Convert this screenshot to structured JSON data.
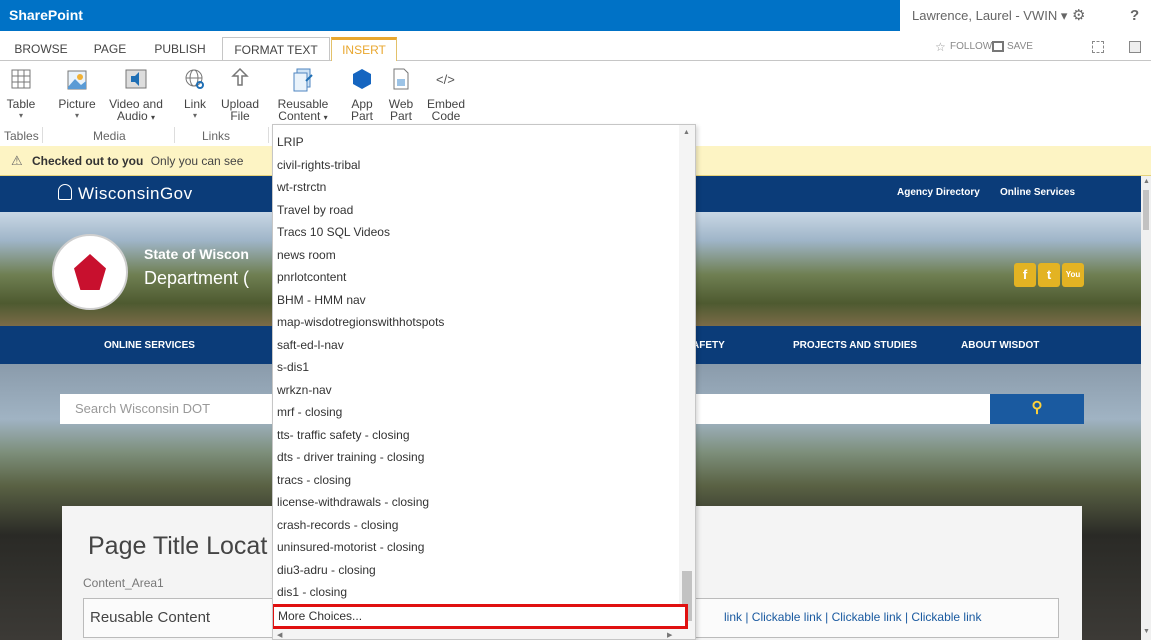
{
  "suite_bar": {
    "brand": "SharePoint",
    "user": "Lawrence, Laurel - VWIN",
    "user_caret": "▾",
    "settings_glyph": "⚙",
    "help_glyph": "?"
  },
  "ribbon_tabs": [
    "BROWSE",
    "PAGE",
    "PUBLISH",
    "FORMAT TEXT",
    "INSERT"
  ],
  "right_actions": {
    "follow": "FOLLOW",
    "save": "SAVE"
  },
  "ribbon": {
    "buttons": [
      {
        "line1": "Table",
        "line2": "",
        "dropdown": "▾"
      },
      {
        "line1": "Picture",
        "line2": "",
        "dropdown": "▾"
      },
      {
        "line1": "Video and",
        "line2": "Audio",
        "dropdown": "▾"
      },
      {
        "line1": "Link",
        "line2": "",
        "dropdown": "▾"
      },
      {
        "line1": "Upload",
        "line2": "File",
        "dropdown": ""
      },
      {
        "line1": "Reusable",
        "line2": "Content",
        "dropdown": "▾"
      },
      {
        "line1": "App",
        "line2": "Part",
        "dropdown": ""
      },
      {
        "line1": "Web",
        "line2": "Part",
        "dropdown": ""
      },
      {
        "line1": "Embed",
        "line2": "Code",
        "dropdown": ""
      }
    ],
    "groups": [
      "Tables",
      "Media",
      "Links"
    ]
  },
  "notice": {
    "icon": "⚠",
    "bold": "Checked out to you",
    "text": "Only you can see"
  },
  "site": {
    "logo": "WisconsinGov",
    "top_links": [
      "Agency Directory",
      "Online Services"
    ],
    "state_title": "State of Wiscon",
    "dept_title": "Department (",
    "social": [
      "f",
      "t",
      "You"
    ],
    "main_nav": [
      "ONLINE SERVICES",
      "AFETY",
      "PROJECTS AND STUDIES",
      "ABOUT WISDOT"
    ],
    "search_placeholder": "Search Wisconsin DOT",
    "search_icon_glyph": "⚲",
    "page_title": "Page Title Locat",
    "content_area": "Content_Area1",
    "reusable_label": "Reusable Content",
    "clickable_links": "link  |  Clickable link  |  Clickable link  |  Clickable link"
  },
  "dropdown": {
    "items": [
      "LRIP",
      "civil-rights-tribal",
      "wt-rstrctn",
      "Travel by road",
      "Tracs 10 SQL Videos",
      "news room",
      "pnrlotcontent",
      "BHM - HMM nav",
      "map-wisdotregionswithhotspots",
      "saft-ed-l-nav",
      "s-dis1",
      "wrkzn-nav",
      "mrf - closing",
      "tts- traffic safety - closing",
      "dts - driver training - closing",
      "tracs - closing",
      "license-withdrawals - closing",
      "crash-records - closing",
      "uninsured-motorist - closing",
      "diu3-adru - closing",
      "dis1 - closing"
    ],
    "more": "More Choices..."
  }
}
